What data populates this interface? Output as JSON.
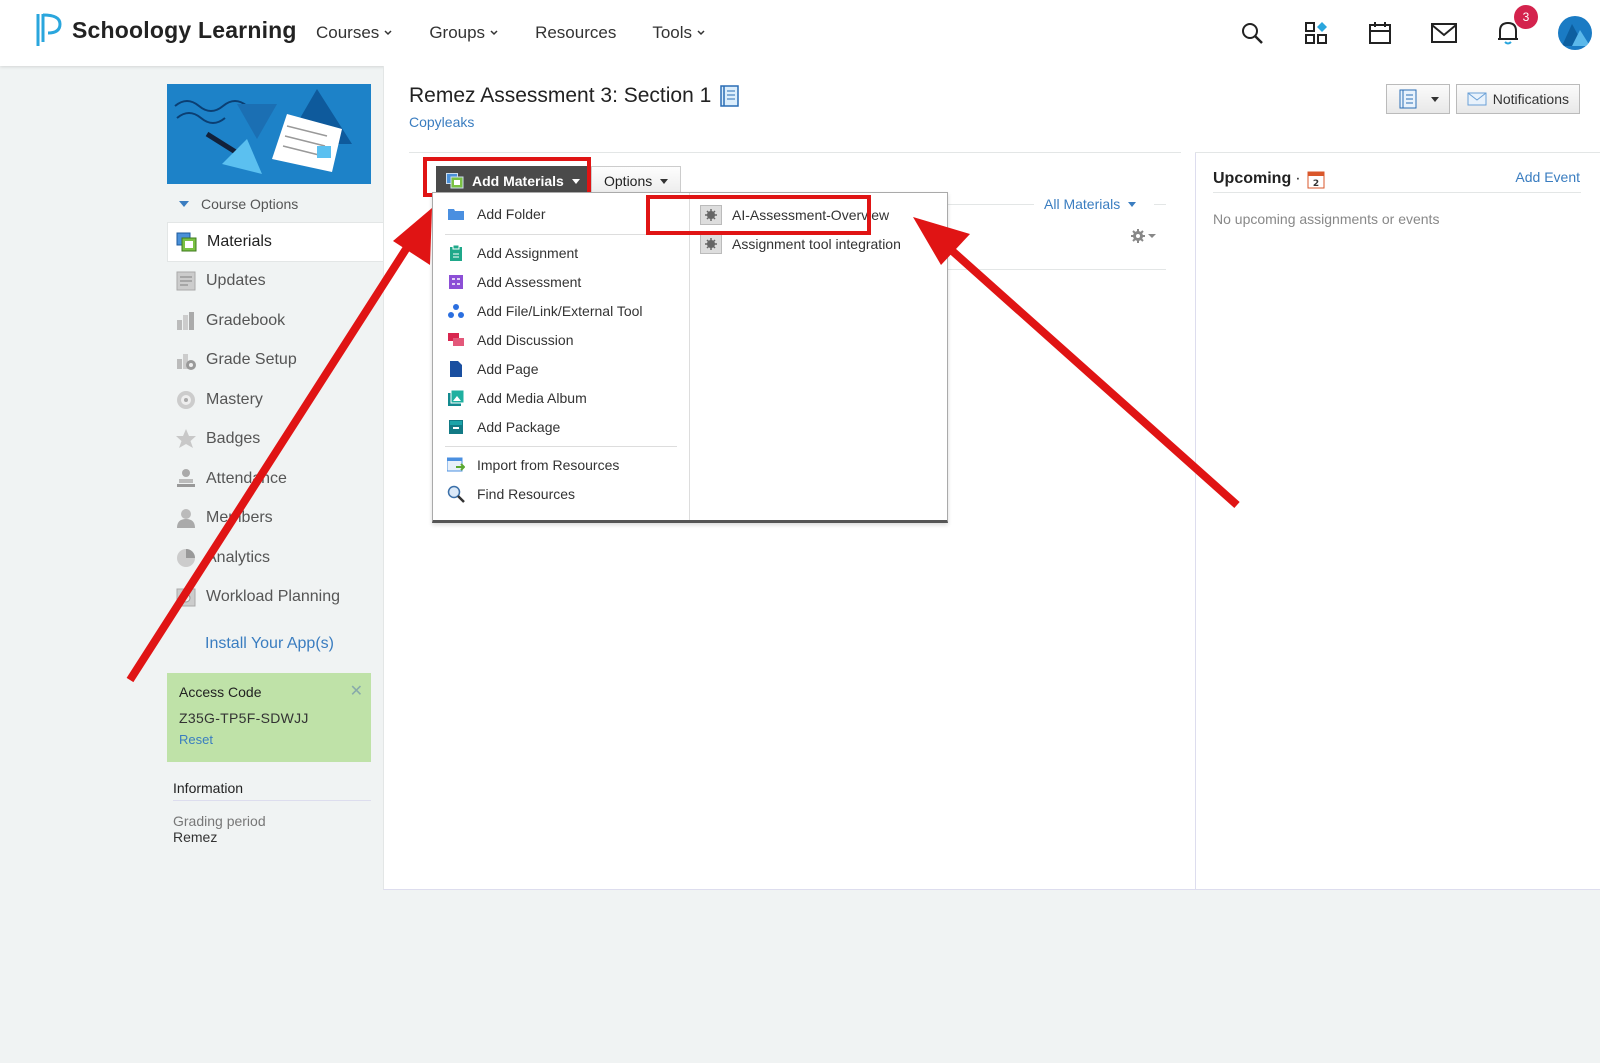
{
  "app": {
    "title": "Schoology Learning"
  },
  "nav": {
    "items": [
      {
        "label": "Courses",
        "has_dropdown": true
      },
      {
        "label": "Groups",
        "has_dropdown": true
      },
      {
        "label": "Resources",
        "has_dropdown": false
      },
      {
        "label": "Tools",
        "has_dropdown": true
      }
    ],
    "icons": [
      "search-icon",
      "apps-icon",
      "calendar-icon",
      "mail-icon",
      "bell-icon"
    ],
    "notification_count": "3"
  },
  "sidebar": {
    "course_options": "Course Options",
    "items": [
      {
        "label": "Materials",
        "icon": "materials-icon",
        "active": true
      },
      {
        "label": "Updates",
        "icon": "updates-icon"
      },
      {
        "label": "Gradebook",
        "icon": "gradebook-icon"
      },
      {
        "label": "Grade Setup",
        "icon": "grade-setup-icon"
      },
      {
        "label": "Mastery",
        "icon": "mastery-icon"
      },
      {
        "label": "Badges",
        "icon": "badges-icon"
      },
      {
        "label": "Attendance",
        "icon": "attendance-icon"
      },
      {
        "label": "Members",
        "icon": "members-icon"
      },
      {
        "label": "Analytics",
        "icon": "analytics-icon"
      },
      {
        "label": "Workload Planning",
        "icon": "workload-icon"
      }
    ],
    "install_apps": "Install Your App(s)",
    "access_code": {
      "title": "Access Code",
      "code": "Z35G-TP5F-SDWJJ",
      "reset": "Reset"
    },
    "information": {
      "heading": "Information",
      "grading_label": "Grading period",
      "grading_value": "Remez"
    }
  },
  "main": {
    "title": "Remez Assessment 3: Section 1",
    "subtitle": "Copyleaks",
    "notifications_button": "Notifications",
    "add_materials": "Add Materials",
    "options": "Options",
    "all_materials": "All Materials",
    "dropdown": {
      "col1": [
        {
          "label": "Add Folder",
          "icon": "folder-icon"
        },
        {
          "label": "Add Assignment",
          "icon": "assignment-icon"
        },
        {
          "label": "Add Assessment",
          "icon": "assessment-icon"
        },
        {
          "label": "Add File/Link/External Tool",
          "icon": "file-link-icon"
        },
        {
          "label": "Add Discussion",
          "icon": "discussion-icon"
        },
        {
          "label": "Add Page",
          "icon": "page-icon"
        },
        {
          "label": "Add Media Album",
          "icon": "media-album-icon"
        },
        {
          "label": "Add Package",
          "icon": "package-icon"
        },
        {
          "label": "Import from Resources",
          "icon": "import-icon"
        },
        {
          "label": "Find Resources",
          "icon": "find-icon"
        }
      ],
      "col2": [
        {
          "label": "AI-Assessment-Overview",
          "icon": "app-tool-icon"
        },
        {
          "label": "Assignment tool integration",
          "icon": "app-tool-icon"
        }
      ]
    }
  },
  "upcoming": {
    "title": "Upcoming",
    "add_event": "Add Event",
    "empty": "No upcoming assignments or events",
    "calendar_day": "2"
  },
  "colors": {
    "accent": "#3a7dc0",
    "annotation_red": "#e01414",
    "access_bg": "#bfe2a8",
    "badge": "#d4234d"
  }
}
